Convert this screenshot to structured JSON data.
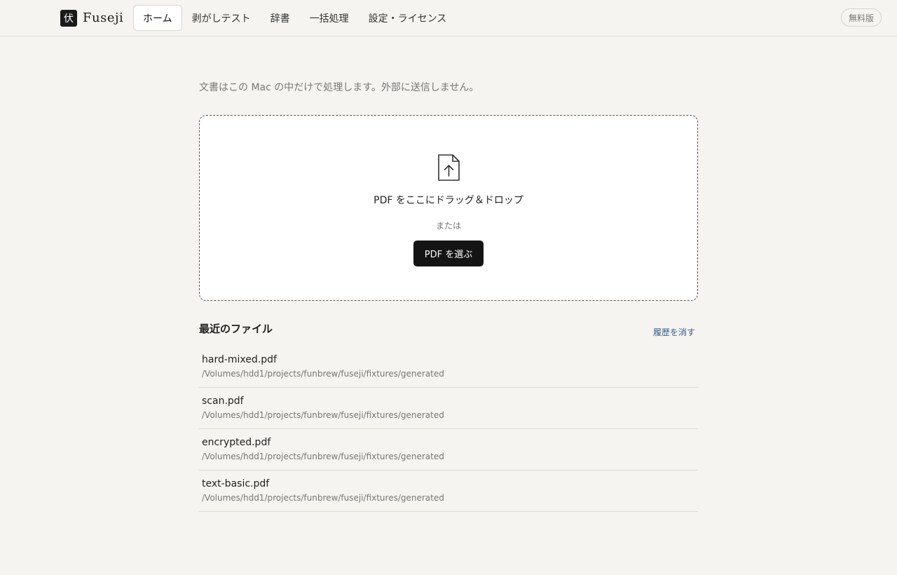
{
  "header": {
    "brand_mark": "伏",
    "brand_name": "Fuseji",
    "nav": [
      {
        "label": "ホーム",
        "active": true
      },
      {
        "label": "剥がしテスト",
        "active": false
      },
      {
        "label": "辞書",
        "active": false
      },
      {
        "label": "一括処理",
        "active": false
      },
      {
        "label": "設定・ライセンス",
        "active": false
      }
    ],
    "plan_badge": "無料版"
  },
  "main": {
    "notice": "文書はこの Mac の中だけで処理します。外部に送信しません。",
    "dropzone": {
      "icon": "file-upload-icon",
      "title": "PDF をここにドラッグ＆ドロップ",
      "or_text": "または",
      "button_label": "PDF を選ぶ"
    },
    "recent": {
      "title": "最近のファイル",
      "clear_label": "履歴を消す",
      "files": [
        {
          "name": "hard-mixed.pdf",
          "path": "/Volumes/hdd1/projects/funbrew/fuseji/fixtures/generated"
        },
        {
          "name": "scan.pdf",
          "path": "/Volumes/hdd1/projects/funbrew/fuseji/fixtures/generated"
        },
        {
          "name": "encrypted.pdf",
          "path": "/Volumes/hdd1/projects/funbrew/fuseji/fixtures/generated"
        },
        {
          "name": "text-basic.pdf",
          "path": "/Volumes/hdd1/projects/funbrew/fuseji/fixtures/generated"
        }
      ]
    }
  },
  "colors": {
    "background": "#f5f4f0",
    "accent_dark": "#141414",
    "link": "#3b5b8a"
  }
}
